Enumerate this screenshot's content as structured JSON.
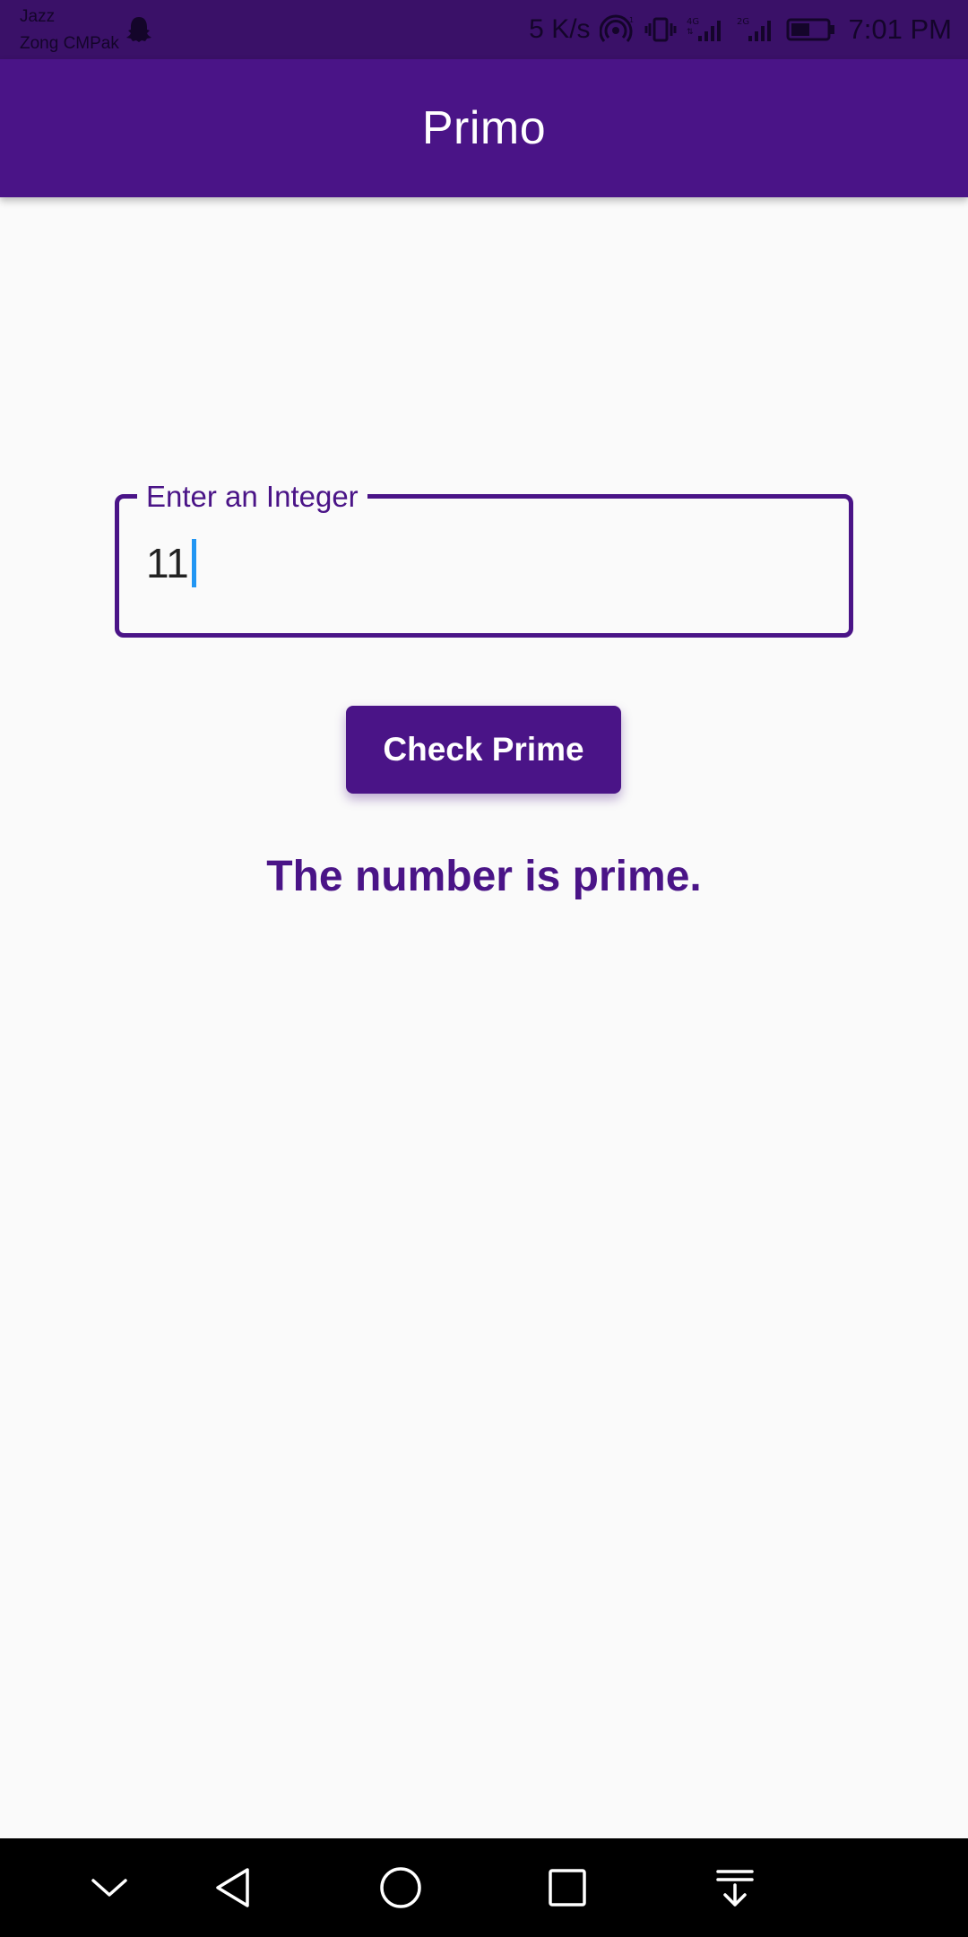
{
  "status_bar": {
    "carrier_1": "Jazz",
    "carrier_2": "Zong CMPak",
    "net_speed": "5 K/s",
    "time": "7:01 PM",
    "icons": [
      "snapchat-ghost-icon",
      "hotspot-icon",
      "vibrate-icon",
      "signal-4g-icon",
      "signal-2g-icon",
      "battery-icon"
    ]
  },
  "app_bar": {
    "title": "Primo"
  },
  "input": {
    "label": "Enter an Integer",
    "value": "11"
  },
  "button": {
    "label": "Check Prime"
  },
  "result": {
    "text": "The number is prime."
  },
  "nav_bar": {
    "icons": [
      "chevron-down-icon",
      "back-icon",
      "home-icon",
      "recents-icon",
      "notification-pull-icon"
    ]
  },
  "colors": {
    "primary": "#4a1487",
    "status_bar": "#3a1168",
    "cursor": "#2196f3",
    "background": "#fafafa"
  }
}
